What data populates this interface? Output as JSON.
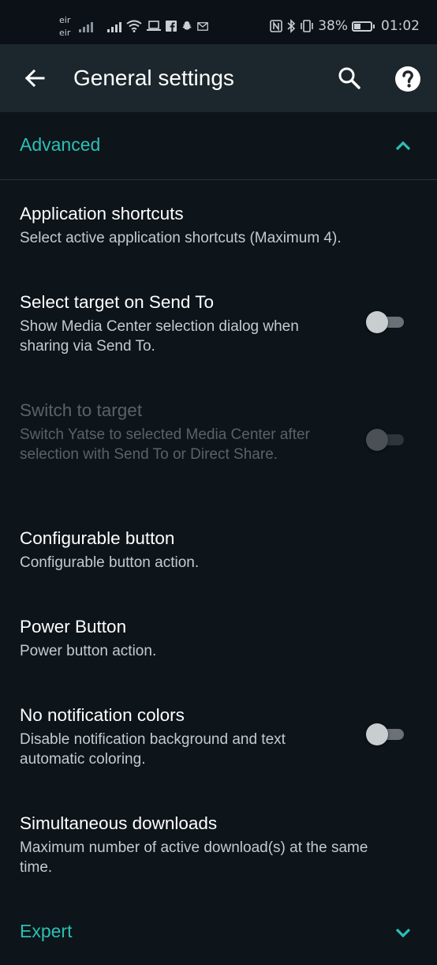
{
  "status_bar": {
    "carrier_1": "eir",
    "carrier_2": "eir",
    "battery_percent": "38%",
    "battery_level": 0.38,
    "time": "01:02",
    "icons": [
      "signal-icon",
      "signal-icon",
      "wifi-icon",
      "laptop-icon",
      "facebook-icon",
      "snapchat-icon",
      "mail-icon",
      "nfc-icon",
      "bluetooth-icon",
      "vibrate-icon",
      "battery-icon"
    ]
  },
  "app_bar": {
    "title": "General settings",
    "icons": [
      "back-arrow-icon",
      "search-icon",
      "help-icon"
    ]
  },
  "sections": {
    "advanced": {
      "label": "Advanced",
      "expanded": true
    },
    "expert": {
      "label": "Expert",
      "expanded": false
    }
  },
  "settings": [
    {
      "title": "Application shortcuts",
      "summary": "Select active application shortcuts (Maximum 4).",
      "has_toggle": false,
      "enabled": true
    },
    {
      "title": "Select target on Send To",
      "summary": "Show Media Center selection dialog when sharing via Send To.",
      "has_toggle": true,
      "checked": false,
      "enabled": true
    },
    {
      "title": "Switch to target",
      "summary": "Switch Yatse to selected Media Center after selection with Send To or Direct Share.",
      "has_toggle": true,
      "checked": false,
      "enabled": false
    },
    {
      "title": "Configurable button",
      "summary": "Configurable button action.",
      "has_toggle": false,
      "enabled": true
    },
    {
      "title": "Power Button",
      "summary": "Power button action.",
      "has_toggle": false,
      "enabled": true
    },
    {
      "title": "No notification colors",
      "summary": "Disable notification background and text automatic coloring.",
      "has_toggle": true,
      "checked": false,
      "enabled": true
    },
    {
      "title": "Simultaneous downloads",
      "summary": "Maximum number of active download(s) at the same time.",
      "has_toggle": false,
      "enabled": true
    }
  ],
  "colors": {
    "accent": "#2bc0b4",
    "background": "#0d141a",
    "app_bar": "#1c262d",
    "status_bar": "#0b1116"
  }
}
